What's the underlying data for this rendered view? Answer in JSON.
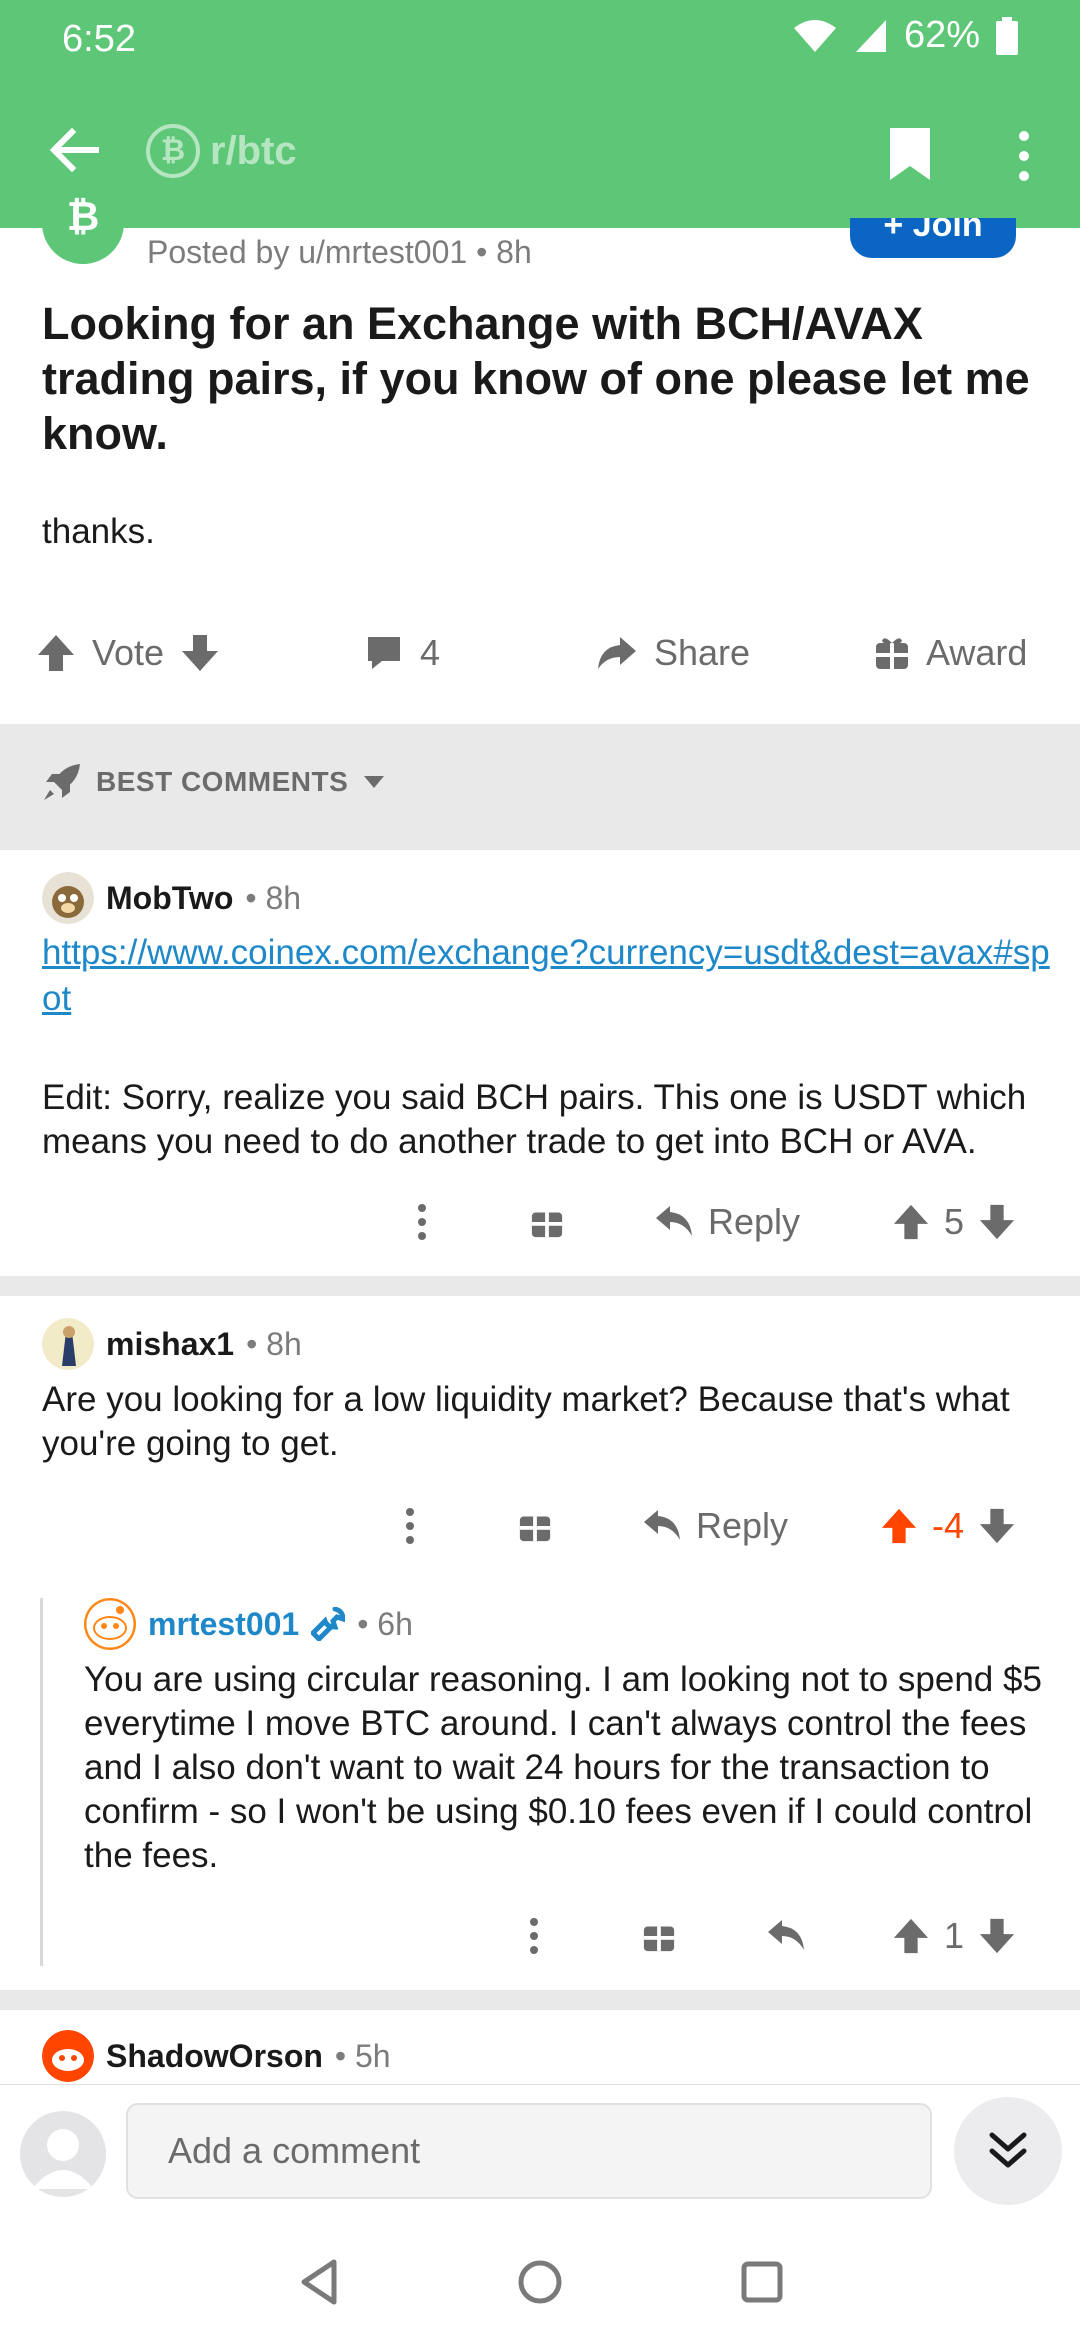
{
  "status": {
    "time": "6:52",
    "battery": "62%"
  },
  "header": {
    "subreddit": "r/btc",
    "sub_icon_glyph": "₿",
    "back_icon": "back-arrow-icon",
    "bookmark_icon": "bookmark-icon",
    "more_icon": "more-vertical-icon"
  },
  "post": {
    "meta": "Posted by u/mrtest001 • 8h",
    "join_label": "+ Join",
    "title": "Looking for an Exchange with BCH/AVAX trading pairs, if you know of one please let me know.",
    "body": "thanks.",
    "actions": {
      "vote_label": "Vote",
      "comment_count": "4",
      "share_label": "Share",
      "award_label": "Award"
    }
  },
  "sort": {
    "label": "BEST COMMENTS"
  },
  "comments": [
    {
      "author": "MobTwo",
      "time": "• 8h",
      "link": "https://www.coinex.com/exchange?currency=usdt&dest=avax#spot",
      "text": "Edit: Sorry, realize you said BCH pairs. This one is USDT which means you need to do another trade to get into BCH or AVA.",
      "reply_label": "Reply",
      "score": "5"
    },
    {
      "author": "mishax1",
      "time": "• 8h",
      "text": "Are you looking for a low liquidity market? Because that's what you're going to get.",
      "reply_label": "Reply",
      "score": "-4"
    },
    {
      "author": "mrtest001",
      "time": "• 6h",
      "text": "You are using circular reasoning.  I am looking not to spend $5 everytime I move BTC around.  I can't always control the fees and I also don't want to wait 24 hours for the transaction to confirm - so I won't be using $0.10 fees even if I could control the fees.",
      "score": "1"
    },
    {
      "author": "ShadowOrson",
      "time": "• 5h"
    }
  ],
  "composer": {
    "placeholder": "Add a comment"
  },
  "colors": {
    "brand_green": "#5dc777",
    "link_blue": "#1e88c8",
    "upvote_orange": "#ff4500",
    "join_blue": "#0a66c2"
  }
}
